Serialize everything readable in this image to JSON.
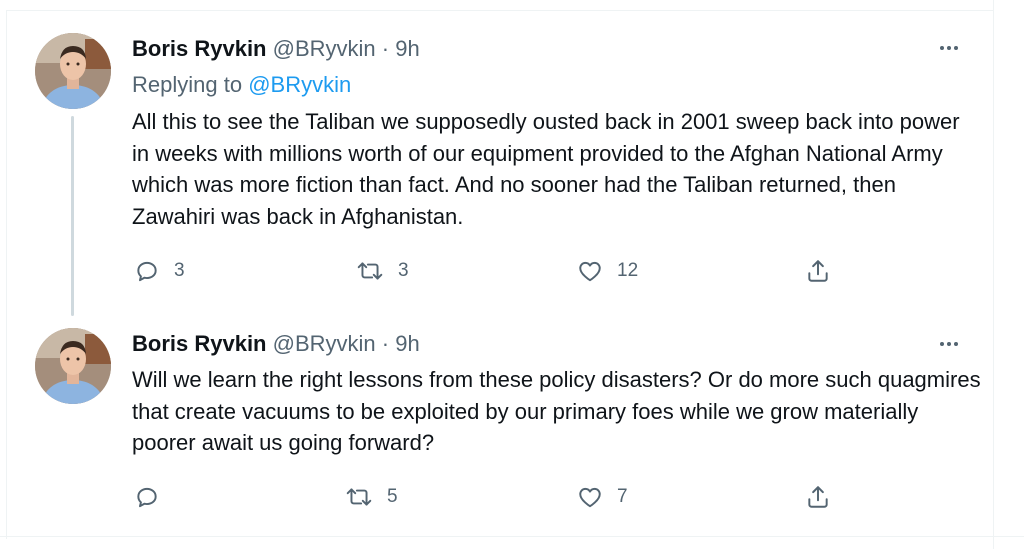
{
  "tweets": [
    {
      "author_name": "Boris Ryvkin",
      "handle": "@BRyvkin",
      "separator": "·",
      "time": "9h",
      "replying_prefix": "Replying to",
      "replying_handle": "@BRyvkin",
      "text": "All this to see the Taliban we supposedly ousted back in 2001 sweep back into power in weeks with millions worth of our equipment provided to the Afghan National Army which was more fiction than fact. And no sooner had the Taliban returned, then Zawahiri was back in Afghanistan.",
      "replies": "3",
      "retweets": "3",
      "likes": "12",
      "icons": {
        "reply": "reply-icon",
        "retweet": "retweet-icon",
        "like": "heart-icon",
        "share": "share-icon",
        "more": "more-icon"
      }
    },
    {
      "author_name": "Boris Ryvkin",
      "handle": "@BRyvkin",
      "separator": "·",
      "time": "9h",
      "text": "Will we learn the right lessons from these policy disasters? Or do more such quagmires that create vacuums to be exploited by our primary foes while we grow materially poorer await us going forward?",
      "replies": "",
      "retweets": "5",
      "likes": "7",
      "icons": {
        "reply": "reply-icon",
        "retweet": "retweet-icon",
        "like": "heart-icon",
        "share": "share-icon",
        "more": "more-icon"
      }
    }
  ],
  "colors": {
    "text": "#0f1419",
    "secondary": "#536471",
    "link": "#1d9bf0",
    "thread_line": "#cfd9de"
  }
}
